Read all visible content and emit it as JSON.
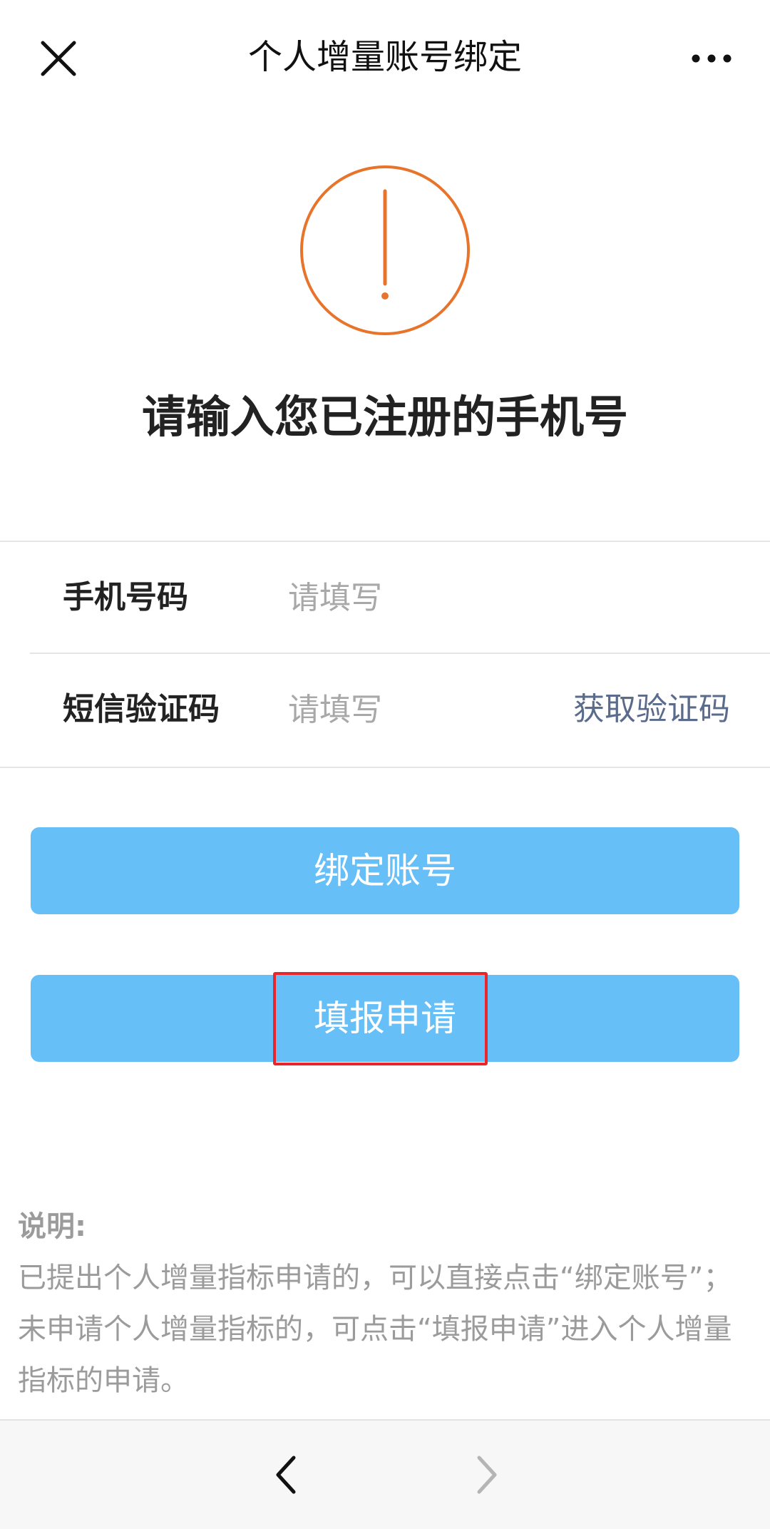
{
  "nav": {
    "title": "个人增量账号绑定",
    "close_icon": "close-icon",
    "more_icon": "more-dots-icon"
  },
  "status": {
    "icon": "exclamation-circle-icon",
    "icon_color": "#E8732A",
    "headline": "请输入您已注册的手机号"
  },
  "form": {
    "phone": {
      "label": "手机号码",
      "value": "",
      "placeholder": "请填写"
    },
    "sms": {
      "label": "短信验证码",
      "value": "",
      "placeholder": "请填写",
      "get_code_label": "获取验证码"
    }
  },
  "buttons": {
    "bind_label": "绑定账号",
    "apply_label": "填报申请",
    "color": "#67BFF7"
  },
  "note": {
    "title": "说明:",
    "body": "已提出个人增量指标申请的，可以直接点击“绑定账号”；未申请个人增量指标的，可点击“填报申请”进入个人增量指标的申请。"
  },
  "bottom_bar": {
    "back_icon": "chevron-left-icon",
    "forward_icon": "chevron-right-icon"
  },
  "annotation": {
    "highlight_color": "#E8262B"
  }
}
